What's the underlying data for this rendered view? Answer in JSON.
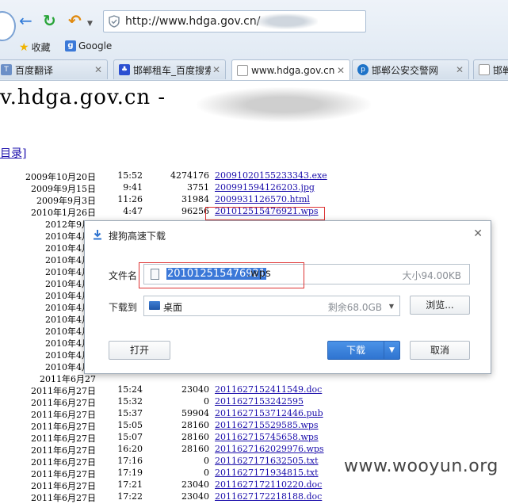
{
  "browser": {
    "url": "http://www.hdga.gov.cn/",
    "bookmarks": [
      "收藏",
      "Google"
    ],
    "tabs": [
      {
        "label": "百度翻译"
      },
      {
        "label": "邯郸租车_百度搜索"
      },
      {
        "label": "www.hdga.gov.cn"
      },
      {
        "label": "邯郸公安交警网"
      },
      {
        "label": "邯郸"
      }
    ]
  },
  "page": {
    "title": "v.hdga.gov.cn -",
    "dir_link": "目录]",
    "listing": [
      {
        "date": "2009年10月20日",
        "time": "15:52",
        "size": "4274176",
        "name": "20091020155233343.exe"
      },
      {
        "date": "2009年9月15日",
        "time": "9:41",
        "size": "3751",
        "name": "200991594126203.jpg"
      },
      {
        "date": "2009年9月3日",
        "time": "11:26",
        "size": "31984",
        "name": "2009931126570.html"
      },
      {
        "date": "2010年1月26日",
        "time": "4:47",
        "size": "96256",
        "name": "201012515476921.wps"
      },
      {
        "date": "2012年9月2",
        "time": "",
        "size": "",
        "name": ""
      },
      {
        "date": "2010年4月2",
        "time": "",
        "size": "",
        "name": ""
      },
      {
        "date": "2010年4月2",
        "time": "",
        "size": "",
        "name": ""
      },
      {
        "date": "2010年4月2",
        "time": "",
        "size": "",
        "name": ""
      },
      {
        "date": "2010年4月2",
        "time": "",
        "size": "",
        "name": ""
      },
      {
        "date": "2010年4月2",
        "time": "",
        "size": "",
        "name": ""
      },
      {
        "date": "2010年4月2",
        "time": "",
        "size": "",
        "name": ""
      },
      {
        "date": "2010年4月2",
        "time": "",
        "size": "",
        "name": ""
      },
      {
        "date": "2010年4月2",
        "time": "",
        "size": "",
        "name": ""
      },
      {
        "date": "2010年4月2",
        "time": "",
        "size": "",
        "name": ""
      },
      {
        "date": "2010年4月2",
        "time": "",
        "size": "",
        "name": ""
      },
      {
        "date": "2010年4月2",
        "time": "",
        "size": "",
        "name": ""
      },
      {
        "date": "2010年4月2",
        "time": "",
        "size": "",
        "name": ""
      },
      {
        "date": "2011年6月27",
        "time": "",
        "size": "",
        "name": ""
      },
      {
        "date": "2011年6月27日",
        "time": "15:24",
        "size": "23040",
        "name": "2011627152411549.doc"
      },
      {
        "date": "2011年6月27日",
        "time": "15:32",
        "size": "0",
        "name": "201162715324259​5"
      },
      {
        "date": "2011年6月27日",
        "time": "15:37",
        "size": "59904",
        "name": "2011627153712446.pub"
      },
      {
        "date": "2011年6月27日",
        "time": "15:05",
        "size": "28160",
        "name": "201162715529585.wps"
      },
      {
        "date": "2011年6月27日",
        "time": "15:07",
        "size": "28160",
        "name": "201162715745658.wps"
      },
      {
        "date": "2011年6月27日",
        "time": "16:20",
        "size": "28160",
        "name": "2011627162029976.wps"
      },
      {
        "date": "2011年6月27日",
        "time": "17:16",
        "size": "0",
        "name": "201162717163250​5.txt"
      },
      {
        "date": "2011年6月27日",
        "time": "17:19",
        "size": "0",
        "name": "201162717193481​5.txt"
      },
      {
        "date": "2011年6月27日",
        "time": "17:21",
        "size": "23040",
        "name": "2011627172110220.doc"
      },
      {
        "date": "2011年6月27日",
        "time": "17:22",
        "size": "23040",
        "name": "2011627172218188.doc"
      }
    ]
  },
  "dialog": {
    "title": "搜狗高速下载",
    "filename_label": "文件名",
    "filename_base": "201012515476921",
    "filename_ext": ".wps",
    "size_text": "大小94.00KB",
    "saveto_label": "下载到",
    "saveto_value": "桌面",
    "free_space": "剩余68.0GB",
    "browse_label": "浏览...",
    "open_label": "打开",
    "download_label": "下载",
    "cancel_label": "取消"
  },
  "watermark": "www.wooyun.org",
  "colors": {
    "link": "#1a0dab",
    "accent": "#2f74d0",
    "highlight": "#d33"
  }
}
